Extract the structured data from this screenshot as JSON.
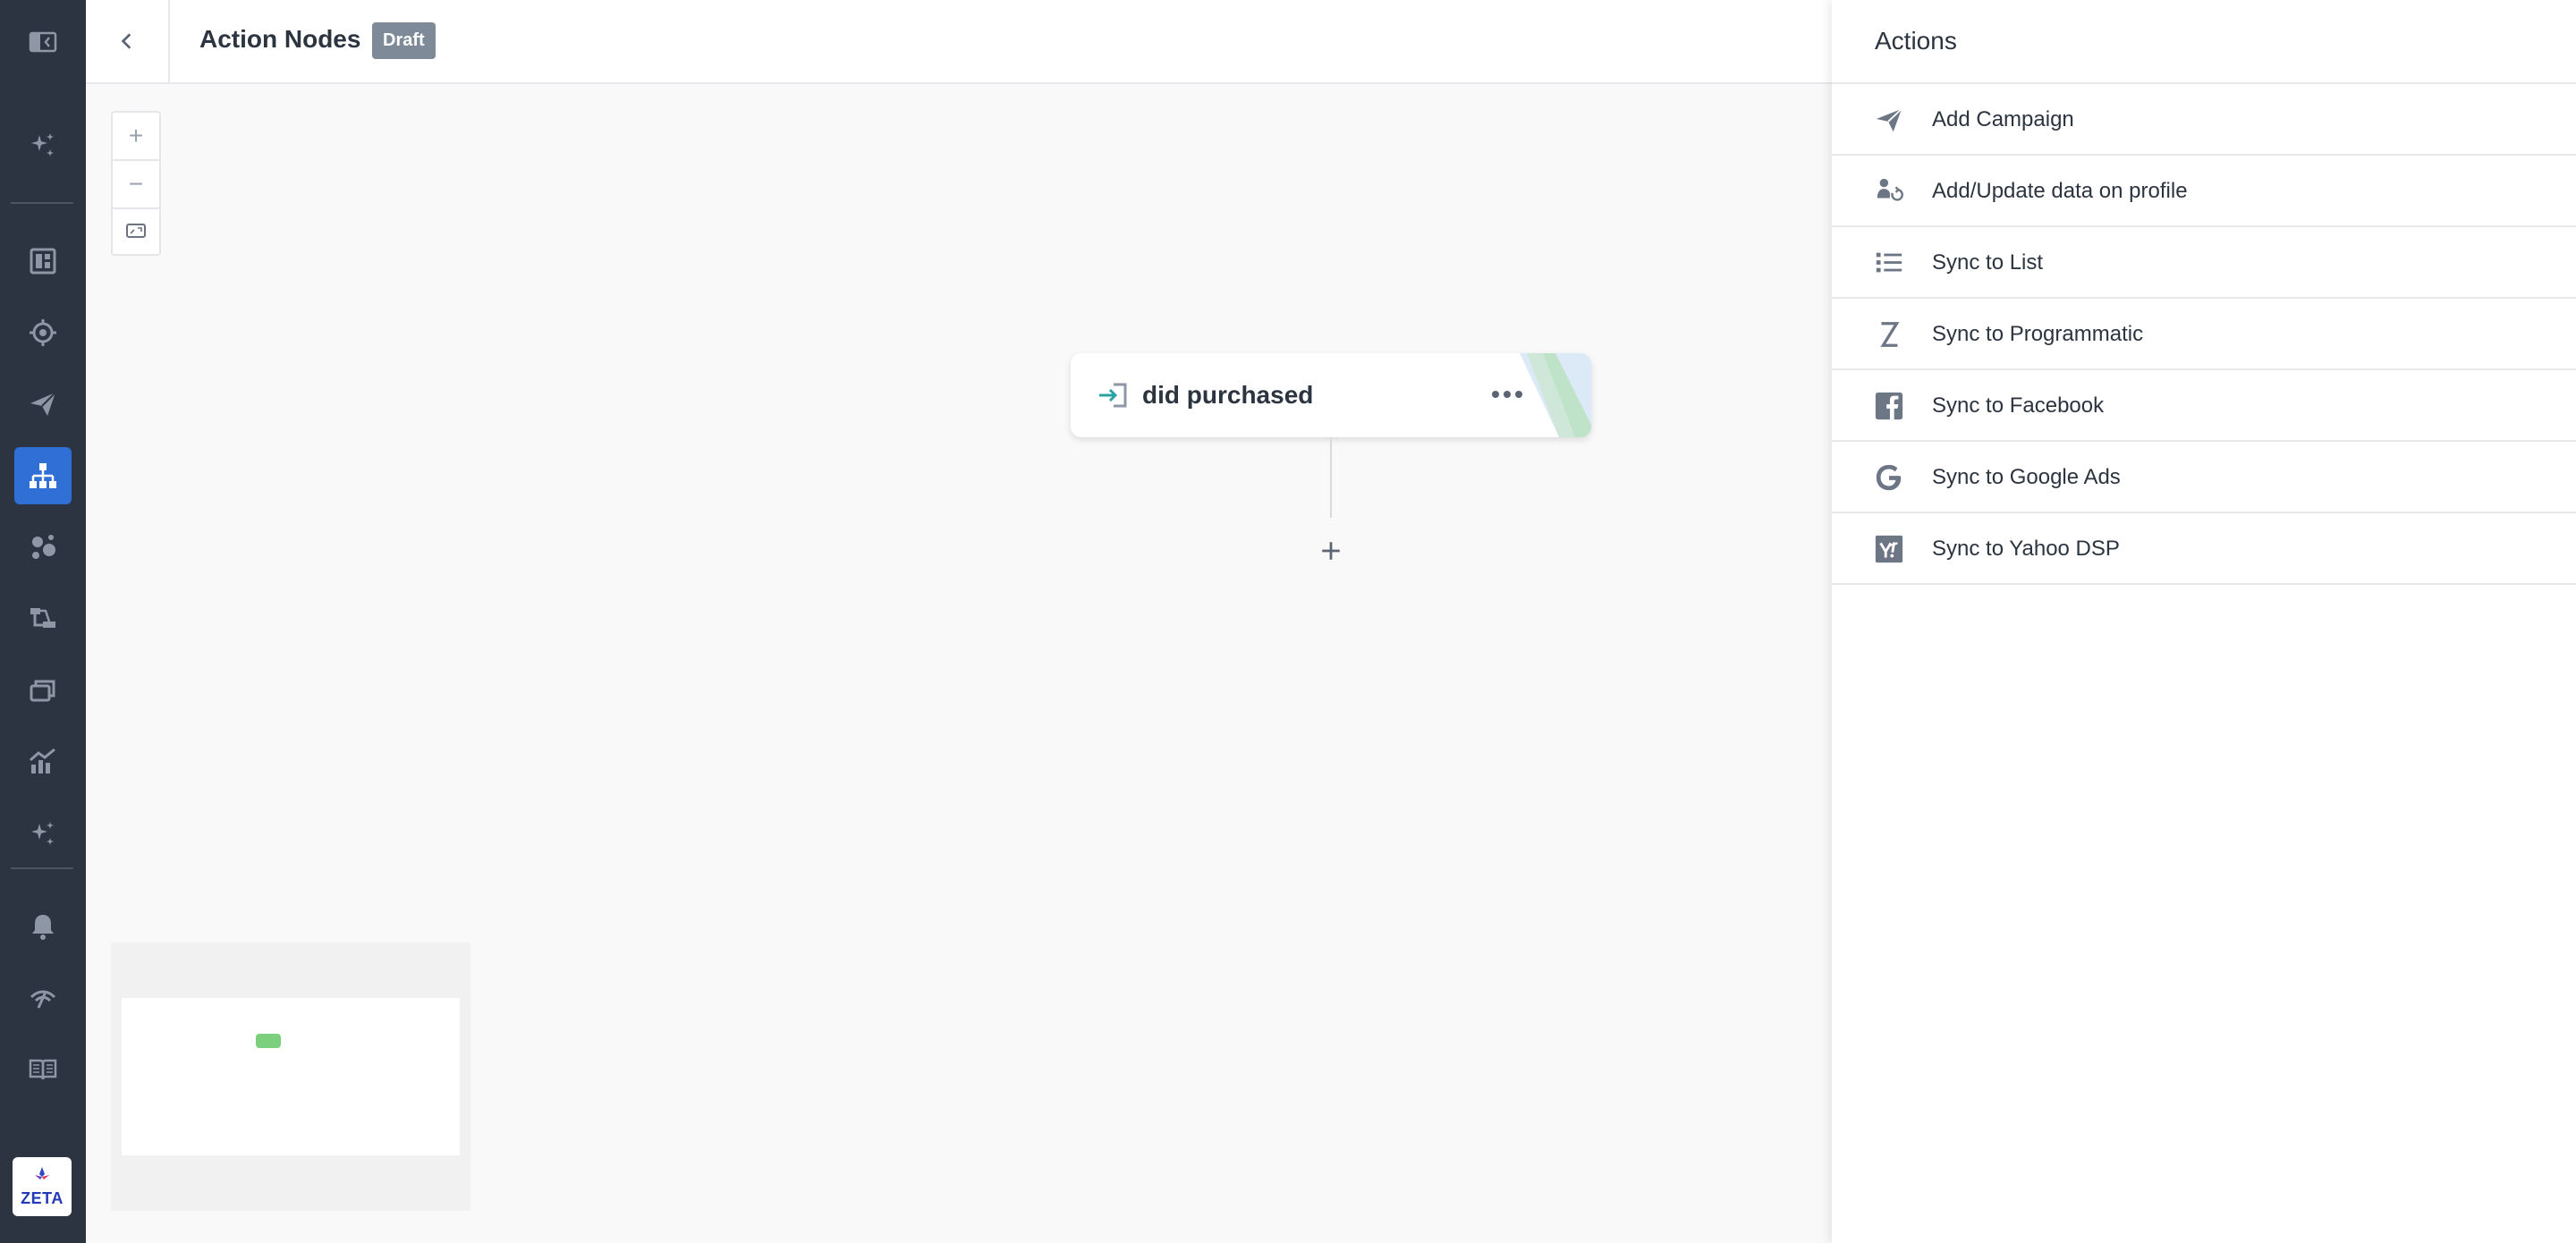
{
  "header": {
    "title": "Action Nodes",
    "badge": "Draft"
  },
  "canvas": {
    "zoom_in_label": "+",
    "zoom_out_label": "−",
    "node": {
      "label": "did purchased"
    },
    "add_label": "+"
  },
  "actions_panel": {
    "title": "Actions",
    "items": [
      {
        "label": "Add Campaign",
        "icon": "paper-plane-icon"
      },
      {
        "label": "Add/Update data on profile",
        "icon": "profile-update-icon"
      },
      {
        "label": "Sync to List",
        "icon": "list-icon"
      },
      {
        "label": "Sync to Programmatic",
        "icon": "programmatic-z-icon"
      },
      {
        "label": "Sync to Facebook",
        "icon": "facebook-icon"
      },
      {
        "label": "Sync to Google Ads",
        "icon": "google-icon"
      },
      {
        "label": "Sync to Yahoo DSP",
        "icon": "yahoo-icon"
      }
    ]
  },
  "brand": {
    "logo_text": "ZETA"
  },
  "colors": {
    "rail_bg": "#2b3440",
    "rail_active": "#2f6fd6",
    "badge_bg": "#7f8a99",
    "node_icon": "#2aa3a3"
  }
}
